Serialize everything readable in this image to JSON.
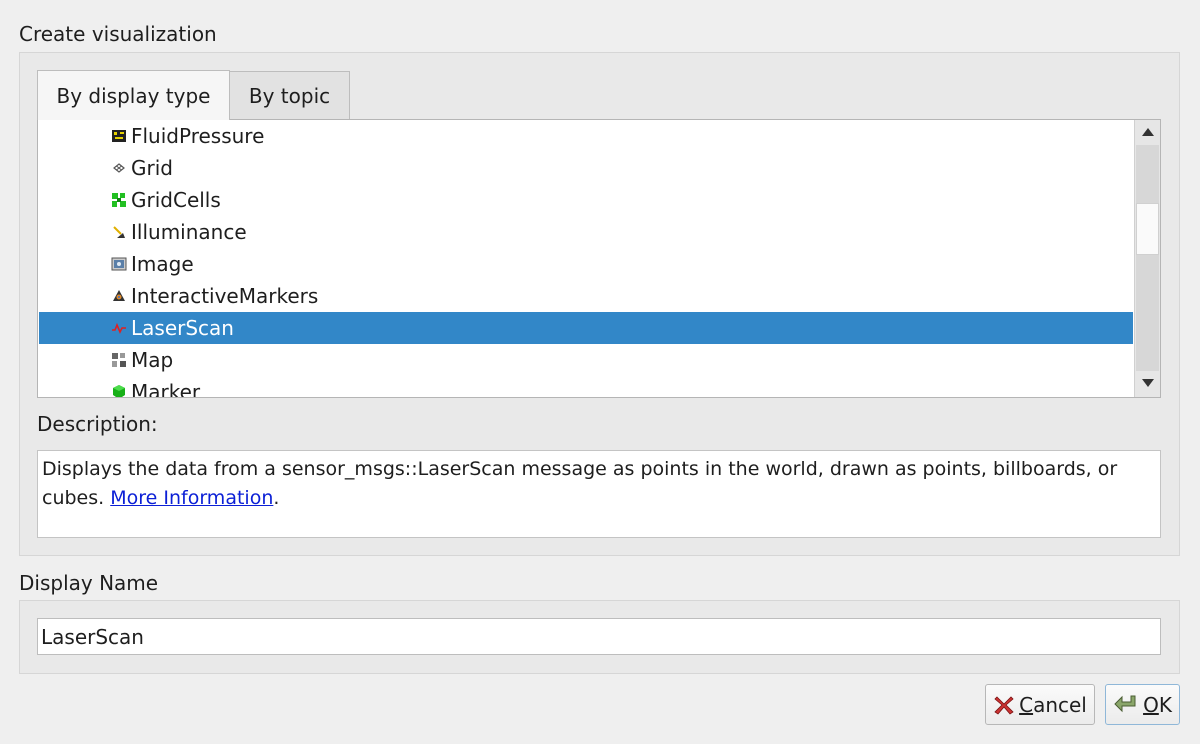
{
  "dialog_title": "Create visualization",
  "tabs": [
    {
      "label": "By display type",
      "active": true
    },
    {
      "label": "By topic",
      "active": false
    }
  ],
  "display_types": [
    {
      "label": "FluidPressure",
      "icon": "fluid-pressure-icon"
    },
    {
      "label": "Grid",
      "icon": "grid-icon"
    },
    {
      "label": "GridCells",
      "icon": "grid-cells-icon"
    },
    {
      "label": "Illuminance",
      "icon": "illuminance-icon"
    },
    {
      "label": "Image",
      "icon": "image-icon"
    },
    {
      "label": "InteractiveMarkers",
      "icon": "interactive-markers-icon"
    },
    {
      "label": "LaserScan",
      "icon": "laser-scan-icon",
      "selected": true
    },
    {
      "label": "Map",
      "icon": "map-icon"
    },
    {
      "label": "Marker",
      "icon": "marker-icon"
    }
  ],
  "description": {
    "label": "Description:",
    "text": "Displays the data from a sensor_msgs::LaserScan message as points in the world, drawn as points, billboards, or cubes.",
    "link_text": "More Information",
    "suffix": "."
  },
  "display_name": {
    "label": "Display Name",
    "value": "LaserScan"
  },
  "buttons": {
    "cancel_prefix": "C",
    "cancel_rest": "ancel",
    "ok_prefix": "O",
    "ok_rest": "K"
  },
  "colors": {
    "selection": "#3287c8",
    "link": "#0b1fd6"
  }
}
